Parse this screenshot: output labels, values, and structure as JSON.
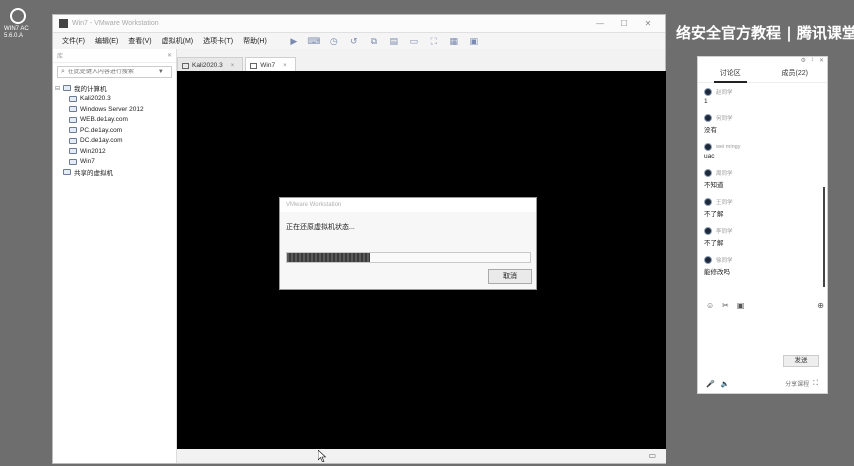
{
  "desktop": {
    "logo_text": "WIN7 AC 5.6.0.A"
  },
  "window": {
    "title": "Win7 - VMware Workstation",
    "controls": {
      "minimize": "—",
      "maximize": "☐",
      "close": "✕"
    }
  },
  "menu": [
    "文件(F)",
    "编辑(E)",
    "查看(V)",
    "虚拟机(M)",
    "选项卡(T)",
    "帮助(H)"
  ],
  "library": {
    "header": "库",
    "search_placeholder": "在此处键入内容进行搜索",
    "root": "我的计算机",
    "items": [
      "Kali2020.3",
      "Windows Server 2012",
      "WEB.de1ay.com",
      "PC.de1ay.com",
      "DC.de1ay.com",
      "Win2012",
      "Win7"
    ],
    "shared": "共享的虚拟机"
  },
  "tabs": [
    {
      "label": "Kali2020.3",
      "close": "×"
    },
    {
      "label": "Win7",
      "close": "×"
    }
  ],
  "dialog": {
    "title": "VMware Workstation",
    "message": "正在还原虚拟机状态...",
    "progress": 0.34,
    "cancel": "取消"
  },
  "banner": {
    "text": "络安全官方教程 | 腾讯课堂"
  },
  "chat": {
    "top_icons": [
      "⚙",
      "↕",
      "✕"
    ],
    "tabs": [
      "讨论区",
      "成员(22)"
    ],
    "messages": [
      {
        "user": "赵同学",
        "text": "1"
      },
      {
        "user": "何同学",
        "text": "没有"
      },
      {
        "user": "wei mingy",
        "text": "uac"
      },
      {
        "user": "周同学",
        "text": "不知道"
      },
      {
        "user": "王同学",
        "text": "不了解"
      },
      {
        "user": "李同学",
        "text": "不了解"
      },
      {
        "user": "徐同学",
        "text": "能修改吗"
      }
    ],
    "tools": [
      "☺",
      "✂",
      "▣",
      "⊕"
    ],
    "send": "发送",
    "bottom_label": "分享课程",
    "bottom_icons": [
      "🎤",
      "🔈",
      "⛶"
    ]
  },
  "colors": {
    "console": "#000000",
    "banner_text": "#ffffff",
    "desktop_bg": "#6e6e6e"
  }
}
